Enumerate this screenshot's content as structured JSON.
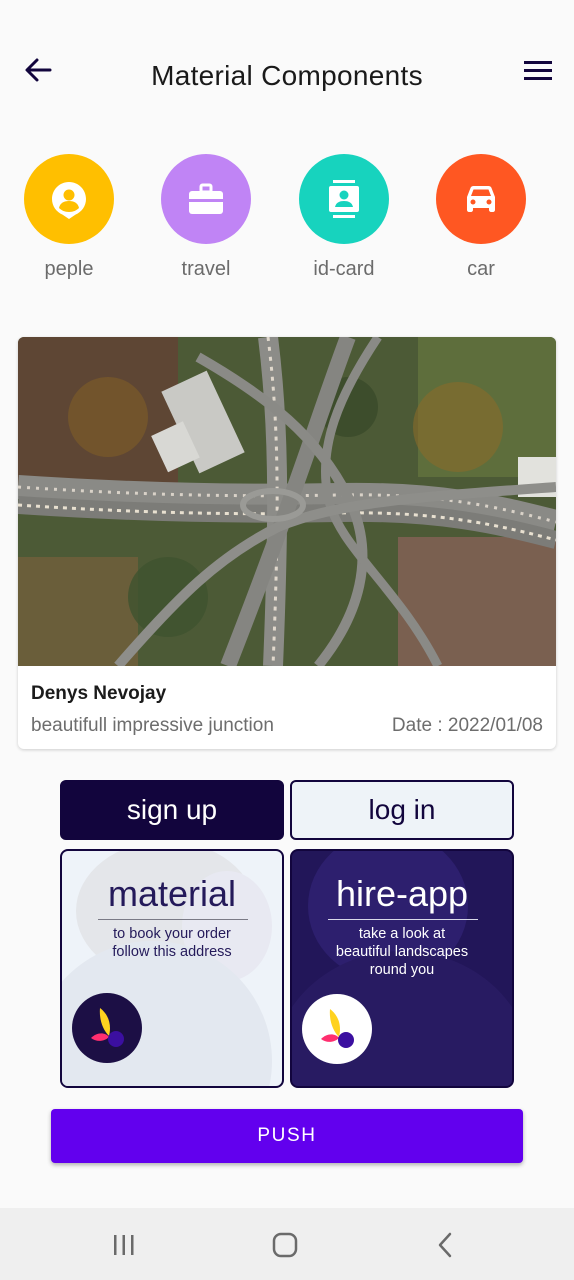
{
  "header": {
    "title": "Material Components",
    "back_icon": "arrow-back-icon",
    "menu_icon": "hamburger-menu-icon"
  },
  "categories": [
    {
      "label": "peple",
      "icon": "person-pin-icon",
      "color": "#ffbf00"
    },
    {
      "label": "travel",
      "icon": "briefcase-icon",
      "color": "#c084f5"
    },
    {
      "label": "id-card",
      "icon": "contact-card-icon",
      "color": "#17d3be"
    },
    {
      "label": "car",
      "icon": "car-icon",
      "color": "#ff5722"
    }
  ],
  "card": {
    "image": "aerial-highway-interchange-photo",
    "author": "Denys Nevojay",
    "caption": "beautifull impressive junction",
    "date": "Date : 2022/01/08"
  },
  "tabs": {
    "signup": "sign up",
    "login": "log in"
  },
  "panels": {
    "material": {
      "title": "material",
      "subtitle": "to book your order\nfollow this address"
    },
    "hire": {
      "title": "hire-app",
      "subtitle": "take a look at\nbeautiful landscapes\nround you"
    }
  },
  "push_button": "PUSH",
  "colors": {
    "primary": "#6200ee",
    "dark_navy": "#12053d",
    "panel_dark": "#221659",
    "panel_light": "#eef3f9"
  }
}
